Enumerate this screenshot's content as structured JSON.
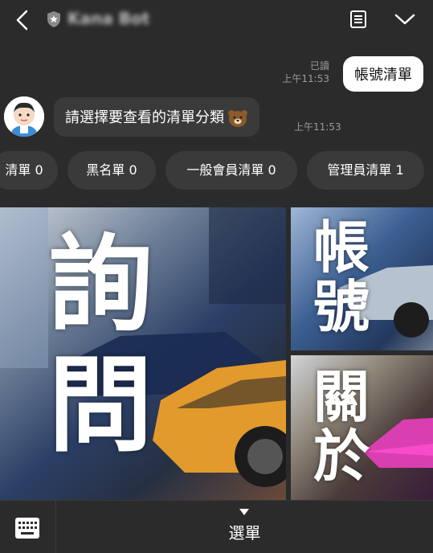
{
  "header": {
    "title": "Kana Bot",
    "icons": {
      "back": "chevron-left-icon",
      "badge": "shield-star-icon",
      "notes": "notes-icon",
      "menu": "chevron-down-icon"
    }
  },
  "chat": {
    "outgoing": {
      "text": "帳號清單",
      "status": "已讀",
      "time": "上午11:53"
    },
    "incoming": {
      "text": "請選擇要查看的清單分類",
      "time": "上午11:53",
      "emoji": "bear-emoji-icon"
    }
  },
  "quick_replies": [
    "清單 0",
    "黑名單 0",
    "一般會員清單 0",
    "管理員清單 1"
  ],
  "rich_menu": {
    "tiles": [
      {
        "label": "詢問",
        "lines": [
          "詢",
          "問"
        ]
      },
      {
        "label": "帳號",
        "lines": [
          "帳",
          "號"
        ]
      },
      {
        "label": "關於",
        "lines": [
          "關",
          "於"
        ]
      }
    ]
  },
  "footer": {
    "menu_label": "選單",
    "keyboard_icon": "keyboard-icon"
  },
  "colors": {
    "background": "#2b2b2b",
    "bubble_in": "#3a3a3a",
    "bubble_out": "#ffffff"
  }
}
